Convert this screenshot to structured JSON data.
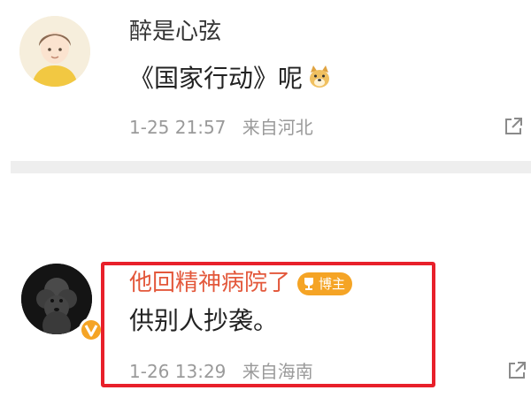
{
  "comments": [
    {
      "username": "醉是心弦",
      "content": "《国家行动》呢",
      "emoji": "doge-icon",
      "date": "1-25",
      "time": "21:57",
      "location": "来自河北"
    },
    {
      "username": "他回精神病院了",
      "author_badge": "博主",
      "content": "供别人抄袭。",
      "date": "1-26",
      "time": "13:29",
      "location": "来自海南",
      "verified": true
    }
  ],
  "colors": {
    "accent_username": "#e3583b",
    "highlight_border": "#e8202a",
    "badge_bg": "#f5a425",
    "meta_text": "#9a9a9a"
  }
}
